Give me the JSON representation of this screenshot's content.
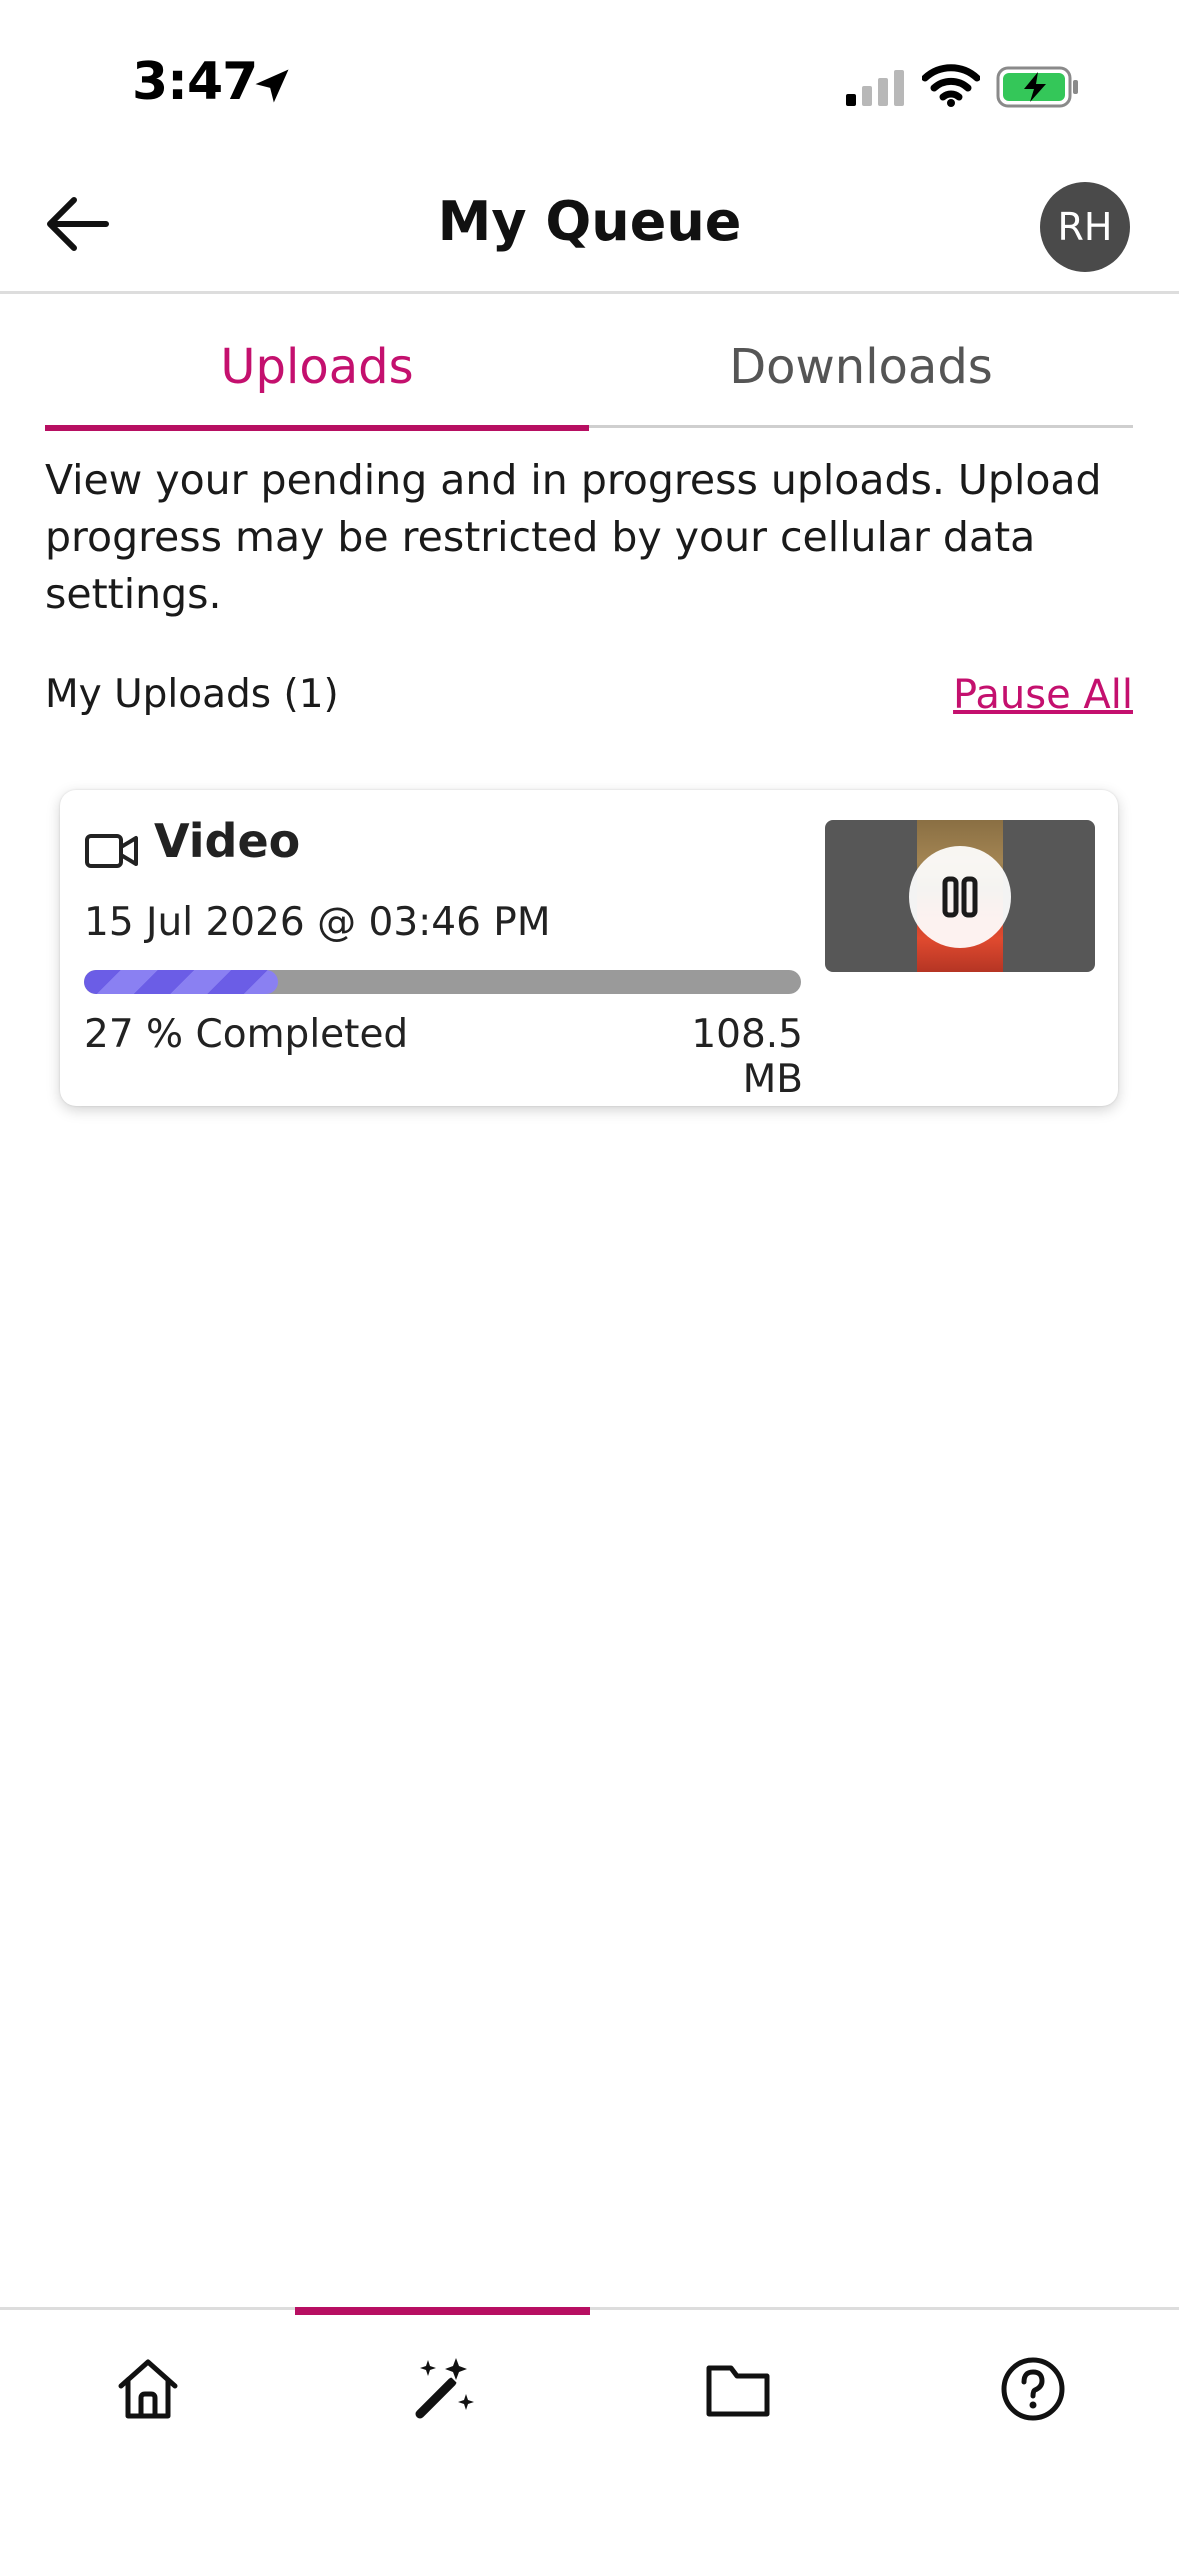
{
  "status_bar": {
    "time": "3:47"
  },
  "header": {
    "title": "My Queue",
    "avatar_initials": "RH"
  },
  "tabs": [
    {
      "label": "Uploads",
      "active": true
    },
    {
      "label": "Downloads",
      "active": false
    }
  ],
  "description": "View your pending and in progress uploads. Upload progress may be restricted by your cellular data settings.",
  "uploads_section": {
    "title": "My Uploads (1)",
    "pause_all_label": "Pause All"
  },
  "upload_item": {
    "media_type": "Video",
    "media_icon": "video-camera-icon",
    "date": "15 Jul 2026 @ 03:46 PM",
    "progress_percent": 27,
    "progress_label": "27 % Completed",
    "size": "108.5 MB",
    "action_icon": "pause-icon"
  },
  "bottom_nav": [
    {
      "icon": "home-icon",
      "active": false
    },
    {
      "icon": "magic-wand-icon",
      "active": true
    },
    {
      "icon": "folder-icon",
      "active": false
    },
    {
      "icon": "help-circle-icon",
      "active": false
    }
  ],
  "colors": {
    "accent": "#c4106e",
    "progress": "#6b5de6",
    "progress_track": "#9a9a9a",
    "avatar_bg": "#4a4a4a"
  }
}
